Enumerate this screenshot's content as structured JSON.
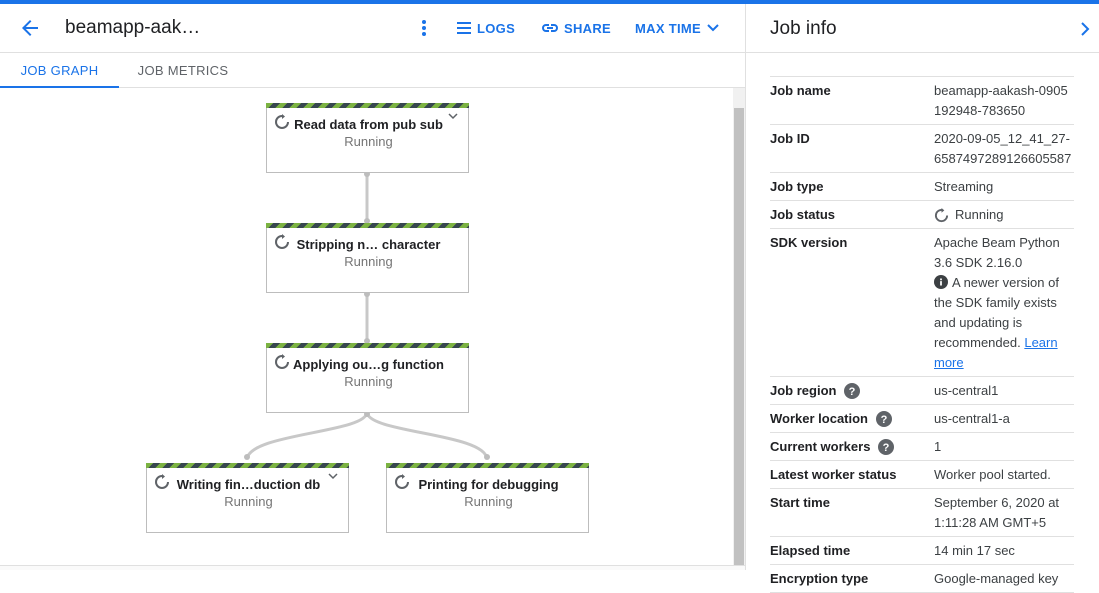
{
  "header": {
    "title": "beamapp-aak…",
    "logs_label": "LOGS",
    "share_label": "SHARE",
    "maxtime_label": "MAX TIME"
  },
  "tabs": [
    {
      "label": "JOB GRAPH",
      "active": true
    },
    {
      "label": "JOB METRICS",
      "active": false
    }
  ],
  "graph": {
    "nodes": [
      {
        "title": "Read data from pub sub",
        "status": "Running",
        "expandable": true
      },
      {
        "title": "Stripping n… character",
        "status": "Running",
        "expandable": false
      },
      {
        "title": "Applying ou…g function",
        "status": "Running",
        "expandable": false
      },
      {
        "title": "Writing fin…duction db",
        "status": "Running",
        "expandable": true
      },
      {
        "title": "Printing for debugging",
        "status": "Running",
        "expandable": false
      }
    ]
  },
  "panel": {
    "title": "Job info",
    "rows": {
      "job_name": {
        "key": "Job name",
        "value": "beamapp-aakash-0905192948-783650"
      },
      "job_id": {
        "key": "Job ID",
        "value": "2020-09-05_12_41_27-6587497289126605587"
      },
      "job_type": {
        "key": "Job type",
        "value": "Streaming"
      },
      "job_status": {
        "key": "Job status",
        "value": "Running"
      },
      "sdk_version": {
        "key": "SDK version",
        "value": "Apache Beam Python 3.6 SDK 2.16.0",
        "notice": "A newer version of the SDK family exists and updating is recommended.",
        "link": "Learn more"
      },
      "job_region": {
        "key": "Job region",
        "value": "us-central1"
      },
      "worker_location": {
        "key": "Worker location",
        "value": "us-central1-a"
      },
      "current_workers": {
        "key": "Current workers",
        "value": "1"
      },
      "latest_worker_status": {
        "key": "Latest worker status",
        "value": "Worker pool started."
      },
      "start_time": {
        "key": "Start time",
        "value": "September 6, 2020 at 1:11:28 AM GMT+5"
      },
      "elapsed_time": {
        "key": "Elapsed time",
        "value": "14 min 17 sec"
      },
      "encryption_type": {
        "key": "Encryption type",
        "value": "Google-managed key"
      }
    }
  },
  "colors": {
    "accent": "#1a73e8",
    "running_stripe_green": "#7cb342",
    "running_stripe_dark": "#37474f"
  }
}
